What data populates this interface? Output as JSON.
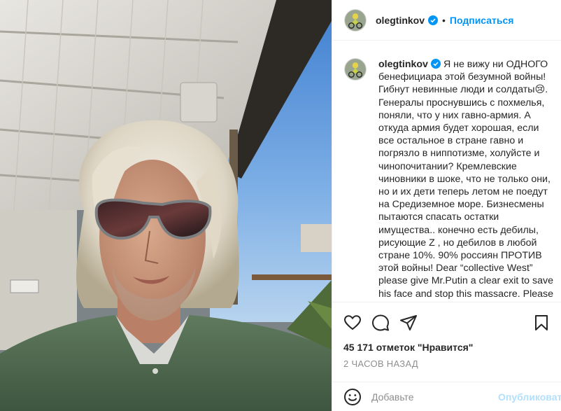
{
  "post": {
    "author": {
      "username": "olegtinkov",
      "verified": true,
      "avatar_icon": "avatar-cyclist"
    },
    "header": {
      "separator": "•",
      "follow_label": "Подписаться"
    },
    "photo": {
      "image_icon": "selfie-photo"
    },
    "caption": {
      "username": "olegtinkov",
      "text": "Я не вижу ни ОДНОГО бенефициара этой безумной войны! Гибнут невинные люди и солдаты😢. Генералы проснувшись с похмелья, поняли, что у них гавно-армия. А откуда армия будет хорошая, если все остальное в стране гавно и погрязло в ниппотизме, холуйсте и чинопочитании? Кремлевские чиновники в шоке, что не только они, но и их дети теперь летом не поедут на Средиземное море. Бизнесмены пытаются спасать остатки имущества.. конечно есть дебилы, рисующие Z , но дебилов в любой стране 10%. 90% россиян ПРОТИВ этой войны! Dear “collective West” please give Mr.Putin a clear exit to save his face and stop this massacre. Please be more rational and humanistic."
    },
    "actions": {
      "like_icon": "heart-icon",
      "comment_icon": "comment-icon",
      "share_icon": "share-icon",
      "save_icon": "bookmark-icon"
    },
    "likes_text": "45 171 отметок \"Нравится\"",
    "time_text": "2 ЧАСОВ НАЗАД",
    "comment_box": {
      "placeholder": "Добавьте",
      "publish_label": "Опубликовать",
      "emoji_icon": "emoji-icon"
    }
  },
  "colors": {
    "accent": "#0095f6",
    "publish_disabled": "#b2dffc",
    "text": "#262626",
    "muted": "#8e8e8e",
    "divider": "#efefef"
  }
}
